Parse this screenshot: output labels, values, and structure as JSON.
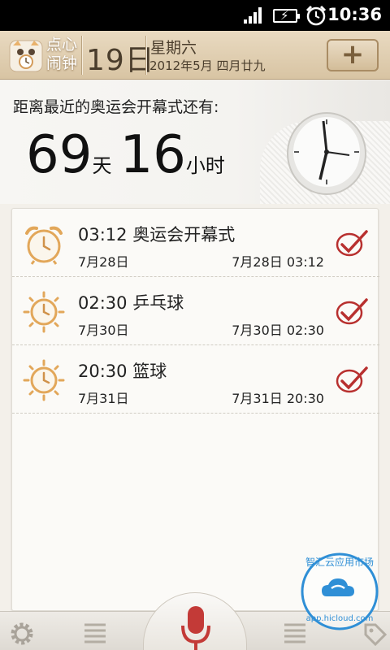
{
  "status_bar": {
    "time": "10:36",
    "icons": [
      "signal-icon",
      "battery-charging-icon",
      "alarm-status-icon"
    ]
  },
  "header": {
    "app_name_line1": "点心",
    "app_name_line2": "闹钟",
    "day_number": "19日",
    "weekday": "星期六",
    "date_full": "2012年5月 四月廿九",
    "add_button_label": "+"
  },
  "countdown": {
    "caption": "距离最近的奥运会开幕式还有:",
    "days": "69",
    "days_unit": "天",
    "hours": "16",
    "hours_unit": "小时"
  },
  "alarms": [
    {
      "title": "03:12 奥运会开幕式",
      "date": "7月28日",
      "next": "7月28日 03:12",
      "icon": "alarm-clock-icon",
      "enabled": true
    },
    {
      "title": "02:30 乒乓球",
      "date": "7月30日",
      "next": "7月30日 02:30",
      "icon": "sun-icon",
      "enabled": true
    },
    {
      "title": "20:30 篮球",
      "date": "7月31日",
      "next": "7月31日 20:30",
      "icon": "sun-icon",
      "enabled": true
    }
  ],
  "bottom_bar": {
    "icons": [
      "settings-icon",
      "list-icon",
      "microphone-icon",
      "list-icon",
      "tag-icon"
    ]
  },
  "watermark": {
    "text_cn": "智汇云应用市场",
    "text_url": "app.hicloud.com"
  },
  "colors": {
    "header_bg": "#dcc8a8",
    "accent_red": "#b8302f",
    "alarm_icon_orange": "#e2a75a"
  }
}
